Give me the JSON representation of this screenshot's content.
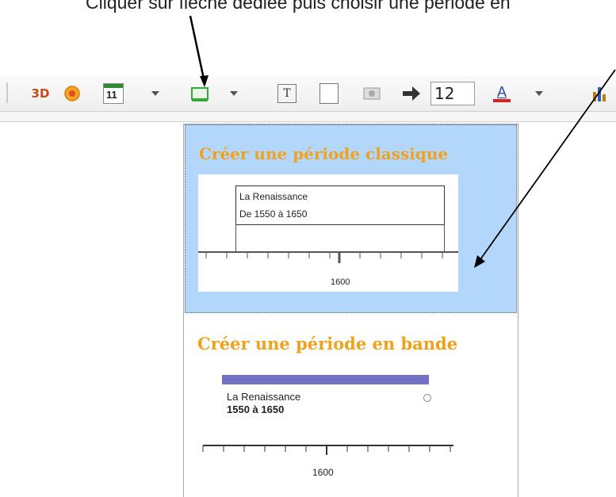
{
  "instruction": {
    "text": "Cliquer sur flèche dédiée puis choisir une période en"
  },
  "toolbar": {
    "items": [
      {
        "name": "3d-icon",
        "label": "3D"
      },
      {
        "name": "orange-globe-icon"
      },
      {
        "name": "calendar-icon",
        "label": "11"
      },
      {
        "name": "period-icon"
      },
      {
        "name": "text-box-icon",
        "label": "T"
      },
      {
        "name": "frame-icon"
      },
      {
        "name": "image-icon"
      },
      {
        "name": "arrow-right-icon"
      },
      {
        "name": "font-color-icon",
        "label": "A"
      },
      {
        "name": "chart-icon"
      }
    ],
    "font_size_value": "12",
    "colors": {
      "font_underline": "#e02020",
      "calendar_green": "#2e8b2e",
      "period_green": "#33aa33"
    }
  },
  "dropdown": {
    "classic": {
      "title": "Créer une période classique",
      "preview_line1": "La Renaissance",
      "preview_line2": "De 1550 à 1650",
      "axis_label": "1600"
    },
    "band": {
      "title": "Créer une période en bande",
      "name": "La Renaissance",
      "range": "1550 à 1650",
      "axis_label": "1600",
      "bar_color": "#7171c5"
    }
  },
  "colors": {
    "title_orange": "#f0a21c",
    "selected_bg": "#b3d7fb"
  }
}
